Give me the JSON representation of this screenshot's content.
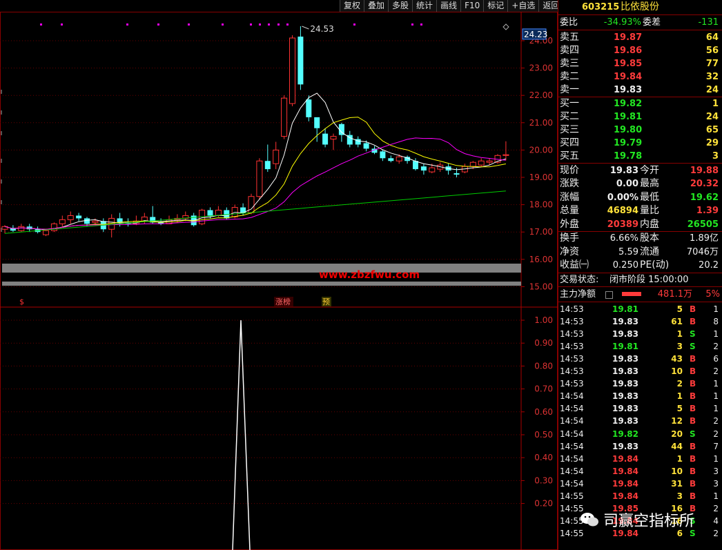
{
  "toolbar": [
    "复权",
    "叠加",
    "多股",
    "统计",
    "画线",
    "F10",
    "标记",
    "+自选",
    "返回"
  ],
  "stock": {
    "code": "603215",
    "name": "比依股份"
  },
  "weibi": {
    "label": "委比",
    "value": "-34.93%",
    "diff_label": "委差",
    "diff": "-131"
  },
  "sells": [
    {
      "label": "卖五",
      "price": "19.87",
      "vol": "64"
    },
    {
      "label": "卖四",
      "price": "19.86",
      "vol": "56"
    },
    {
      "label": "卖三",
      "price": "19.85",
      "vol": "77"
    },
    {
      "label": "卖二",
      "price": "19.84",
      "vol": "32"
    },
    {
      "label": "卖一",
      "price": "19.83",
      "vol": "24"
    }
  ],
  "buys": [
    {
      "label": "买一",
      "price": "19.82",
      "vol": "1"
    },
    {
      "label": "买二",
      "price": "19.81",
      "vol": "24"
    },
    {
      "label": "买三",
      "price": "19.80",
      "vol": "65"
    },
    {
      "label": "买四",
      "price": "19.79",
      "vol": "29"
    },
    {
      "label": "买五",
      "price": "19.78",
      "vol": "3"
    }
  ],
  "quote": [
    {
      "l1": "现价",
      "v1": "19.83",
      "c1": "white",
      "l2": "今开",
      "v2": "19.88",
      "c2": "red"
    },
    {
      "l1": "涨跌",
      "v1": "0.00",
      "c1": "white",
      "l2": "最高",
      "v2": "20.32",
      "c2": "red"
    },
    {
      "l1": "涨幅",
      "v1": "0.00%",
      "c1": "white",
      "l2": "最低",
      "v2": "19.62",
      "c2": "green"
    },
    {
      "l1": "总量",
      "v1": "46894",
      "c1": "yellow",
      "l2": "量比",
      "v2": "1.39",
      "c2": "red"
    },
    {
      "l1": "外盘",
      "v1": "20389",
      "c1": "red",
      "l2": "内盘",
      "v2": "26505",
      "c2": "green"
    }
  ],
  "stats": [
    {
      "l1": "换手",
      "v1": "6.66%",
      "l2": "股本",
      "v2": "1.89亿"
    },
    {
      "l1": "净资",
      "v1": "5.59",
      "l2": "流通",
      "v2": "7046万"
    },
    {
      "l1": "收益㈠",
      "v1": "0.250",
      "l2": "PE(动)",
      "v2": "20.2"
    }
  ],
  "status": {
    "label": "交易状态:",
    "value": "闭市阶段 15:00:00"
  },
  "main_force": {
    "label": "主力净额",
    "value": "481.1万",
    "pct": "5%"
  },
  "ticks": [
    {
      "t": "14:53",
      "p": "19.81",
      "pc": "green",
      "v": "5",
      "vc": "yellow",
      "d": "B",
      "n": "1"
    },
    {
      "t": "14:53",
      "p": "19.83",
      "pc": "white",
      "v": "61",
      "vc": "yellow",
      "d": "B",
      "n": "8"
    },
    {
      "t": "14:53",
      "p": "19.83",
      "pc": "white",
      "v": "1",
      "vc": "yellow",
      "d": "S",
      "n": "1"
    },
    {
      "t": "14:53",
      "p": "19.81",
      "pc": "green",
      "v": "3",
      "vc": "yellow",
      "d": "S",
      "n": "2"
    },
    {
      "t": "14:53",
      "p": "19.83",
      "pc": "white",
      "v": "43",
      "vc": "yellow",
      "d": "B",
      "n": "6"
    },
    {
      "t": "14:53",
      "p": "19.83",
      "pc": "white",
      "v": "10",
      "vc": "yellow",
      "d": "B",
      "n": "2"
    },
    {
      "t": "14:53",
      "p": "19.83",
      "pc": "white",
      "v": "2",
      "vc": "yellow",
      "d": "B",
      "n": "1"
    },
    {
      "t": "14:54",
      "p": "19.83",
      "pc": "white",
      "v": "1",
      "vc": "yellow",
      "d": "B",
      "n": "1"
    },
    {
      "t": "14:54",
      "p": "19.83",
      "pc": "white",
      "v": "5",
      "vc": "yellow",
      "d": "B",
      "n": "1"
    },
    {
      "t": "14:54",
      "p": "19.83",
      "pc": "white",
      "v": "12",
      "vc": "yellow",
      "d": "B",
      "n": "2"
    },
    {
      "t": "14:54",
      "p": "19.82",
      "pc": "green",
      "v": "20",
      "vc": "yellow",
      "d": "S",
      "n": "2"
    },
    {
      "t": "14:54",
      "p": "19.83",
      "pc": "white",
      "v": "44",
      "vc": "yellow",
      "d": "B",
      "n": "7"
    },
    {
      "t": "14:54",
      "p": "19.84",
      "pc": "red",
      "v": "1",
      "vc": "yellow",
      "d": "B",
      "n": "1"
    },
    {
      "t": "14:54",
      "p": "19.84",
      "pc": "red",
      "v": "10",
      "vc": "yellow",
      "d": "B",
      "n": "3"
    },
    {
      "t": "14:54",
      "p": "19.84",
      "pc": "red",
      "v": "31",
      "vc": "yellow",
      "d": "B",
      "n": "3"
    },
    {
      "t": "14:55",
      "p": "19.84",
      "pc": "red",
      "v": "3",
      "vc": "yellow",
      "d": "B",
      "n": "1"
    },
    {
      "t": "14:55",
      "p": "19.85",
      "pc": "red",
      "v": "16",
      "vc": "yellow",
      "d": "B",
      "n": "2"
    },
    {
      "t": "14:55",
      "p": "19.84",
      "pc": "red",
      "v": "16",
      "vc": "yellow",
      "d": "S",
      "n": "4"
    },
    {
      "t": "14:55",
      "p": "19.84",
      "pc": "red",
      "v": "6",
      "vc": "yellow",
      "d": "S",
      "n": "2"
    }
  ],
  "watermark": "司赢空指标所",
  "chart_data": {
    "type": "candlestick",
    "price_axis": [
      "24.00",
      "23.00",
      "22.00",
      "21.00",
      "20.00",
      "19.00",
      "18.00",
      "17.00",
      "16.00",
      "15.00"
    ],
    "current_price_label": "24.23",
    "high_label": "24.53",
    "site_text": "www.zbzfwu.com",
    "marks": {
      "left": "$",
      "zhangting": "涨榜",
      "yu": "预"
    },
    "indicator_axis": [
      "1.00",
      "0.90",
      "0.80",
      "0.70",
      "0.60",
      "0.50",
      "0.40",
      "0.30",
      "0.20"
    ],
    "candles": [
      [
        17.1,
        17.2,
        16.95,
        17.25
      ],
      [
        17.15,
        17.05,
        17.0,
        17.25
      ],
      [
        17.05,
        17.2,
        17.0,
        17.3
      ],
      [
        17.2,
        17.1,
        17.0,
        17.3
      ],
      [
        17.1,
        17.0,
        16.95,
        17.2
      ],
      [
        16.9,
        17.05,
        16.85,
        17.1
      ],
      [
        17.05,
        17.3,
        17.0,
        17.35
      ],
      [
        17.3,
        17.45,
        17.2,
        17.6
      ],
      [
        17.45,
        17.6,
        17.3,
        17.75
      ],
      [
        17.6,
        17.5,
        17.4,
        17.7
      ],
      [
        17.5,
        17.3,
        17.2,
        17.55
      ],
      [
        17.35,
        17.4,
        17.25,
        17.5
      ],
      [
        17.4,
        17.1,
        17.0,
        17.5
      ],
      [
        17.1,
        17.5,
        16.8,
        17.65
      ],
      [
        17.5,
        17.35,
        17.2,
        17.7
      ],
      [
        17.35,
        17.3,
        17.2,
        17.5
      ],
      [
        17.3,
        17.4,
        17.25,
        17.6
      ],
      [
        17.4,
        17.55,
        17.3,
        17.7
      ],
      [
        17.55,
        17.35,
        17.3,
        17.95
      ],
      [
        17.35,
        17.3,
        17.25,
        17.5
      ],
      [
        17.3,
        17.45,
        17.3,
        17.6
      ],
      [
        17.45,
        17.5,
        17.35,
        17.65
      ],
      [
        17.5,
        17.6,
        17.4,
        17.75
      ],
      [
        17.6,
        17.25,
        17.2,
        17.7
      ],
      [
        17.3,
        17.8,
        17.25,
        17.85
      ],
      [
        17.8,
        17.6,
        17.5,
        17.9
      ],
      [
        17.6,
        17.8,
        17.55,
        17.95
      ],
      [
        17.8,
        17.5,
        17.45,
        17.9
      ],
      [
        17.55,
        17.9,
        17.5,
        18.0
      ],
      [
        17.9,
        17.7,
        17.6,
        18.05
      ],
      [
        17.7,
        18.3,
        17.65,
        18.4
      ],
      [
        18.3,
        19.6,
        18.2,
        19.7
      ],
      [
        19.6,
        19.3,
        19.2,
        20.2
      ],
      [
        19.5,
        20.0,
        19.3,
        20.3
      ],
      [
        20.5,
        21.9,
        20.4,
        22.0
      ],
      [
        21.7,
        24.1,
        21.6,
        24.2
      ],
      [
        24.15,
        22.4,
        22.2,
        24.53
      ],
      [
        21.85,
        21.2,
        21.05,
        22.0
      ],
      [
        21.2,
        20.8,
        20.3,
        21.0
      ],
      [
        20.6,
        20.2,
        20.1,
        20.8
      ],
      [
        20.4,
        20.5,
        20.0,
        20.6
      ],
      [
        20.95,
        20.55,
        20.3,
        21.0
      ],
      [
        20.55,
        20.2,
        20.1,
        20.7
      ],
      [
        20.4,
        20.2,
        20.1,
        20.5
      ],
      [
        20.25,
        20.05,
        19.95,
        20.35
      ],
      [
        20.05,
        19.9,
        19.85,
        20.15
      ],
      [
        19.95,
        19.7,
        19.6,
        20.0
      ],
      [
        19.7,
        19.6,
        19.55,
        19.8
      ],
      [
        19.6,
        19.75,
        19.5,
        19.85
      ],
      [
        19.75,
        19.6,
        19.5,
        19.8
      ],
      [
        19.6,
        19.3,
        19.25,
        19.7
      ],
      [
        19.4,
        19.25,
        19.1,
        19.5
      ],
      [
        19.2,
        19.35,
        19.15,
        19.5
      ],
      [
        19.3,
        19.45,
        19.2,
        19.55
      ],
      [
        19.4,
        19.25,
        19.1,
        19.5
      ],
      [
        19.15,
        19.1,
        19.0,
        19.35
      ],
      [
        19.2,
        19.4,
        19.15,
        19.5
      ],
      [
        19.4,
        19.55,
        19.3,
        19.6
      ],
      [
        19.45,
        19.6,
        19.4,
        19.7
      ],
      [
        19.55,
        19.6,
        19.45,
        19.7
      ],
      [
        19.55,
        19.8,
        19.5,
        19.85
      ],
      [
        19.8,
        19.83,
        19.62,
        20.32
      ]
    ]
  }
}
